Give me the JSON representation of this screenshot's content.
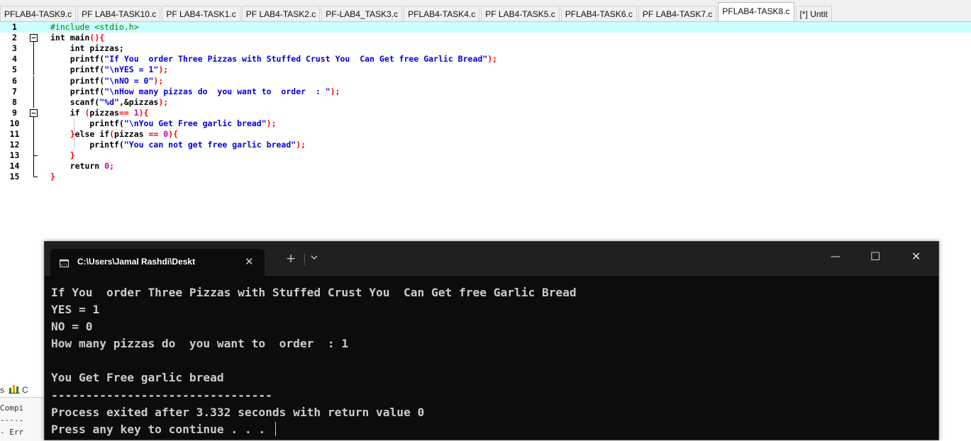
{
  "tabs": [
    {
      "label": "PFLAB4-TASK9.c",
      "active": false
    },
    {
      "label": "PF LAB4-TASK10.c",
      "active": false
    },
    {
      "label": "PF LAB4-TASK1.c",
      "active": false
    },
    {
      "label": "PF LAB4-TASK2.c",
      "active": false
    },
    {
      "label": "PF-LAB4_TASK3.c",
      "active": false
    },
    {
      "label": "PFLAB4-TASK4.c",
      "active": false
    },
    {
      "label": "PF LAB4-TASK5.c",
      "active": false
    },
    {
      "label": "PFLAB4-TASK6.c",
      "active": false
    },
    {
      "label": "PF LAB4-TASK7.c",
      "active": false
    },
    {
      "label": "PFLAB4-TASK8.c",
      "active": true
    },
    {
      "label": "[*] Untit",
      "active": false
    }
  ],
  "editor": {
    "lines": [
      {
        "n": "1",
        "fold": "",
        "parts": [
          [
            "pp",
            "#include <stdio.h>"
          ]
        ],
        "current": true
      },
      {
        "n": "2",
        "fold": "box",
        "parts": [
          [
            "kw",
            "int "
          ],
          [
            "tx",
            "main"
          ],
          [
            "br",
            "(){"
          ]
        ]
      },
      {
        "n": "3",
        "fold": "line",
        "parts": [
          [
            "tx",
            "    int pizzas;"
          ]
        ]
      },
      {
        "n": "4",
        "fold": "line",
        "parts": [
          [
            "tx",
            "    printf("
          ],
          [
            "str",
            "\"If You  order Three Pizzas with Stuffed Crust You  Can Get free Garlic Bread\""
          ],
          [
            "br",
            ");"
          ]
        ]
      },
      {
        "n": "5",
        "fold": "line",
        "parts": [
          [
            "tx",
            "    printf("
          ],
          [
            "str",
            "\"\\nYES = 1\""
          ],
          [
            "br",
            ");"
          ]
        ]
      },
      {
        "n": "6",
        "fold": "line",
        "parts": [
          [
            "tx",
            "    printf("
          ],
          [
            "str",
            "\"\\nNO = 0\""
          ],
          [
            "br",
            ");"
          ]
        ]
      },
      {
        "n": "7",
        "fold": "line",
        "parts": [
          [
            "tx",
            "    printf("
          ],
          [
            "str",
            "\"\\nHow many pizzas do  you want to  order  : \""
          ],
          [
            "br",
            ");"
          ]
        ]
      },
      {
        "n": "8",
        "fold": "line",
        "parts": [
          [
            "tx",
            "    scanf("
          ],
          [
            "str",
            "\"%d\""
          ],
          [
            "tx",
            ",&pizzas"
          ],
          [
            "br",
            ");"
          ]
        ]
      },
      {
        "n": "9",
        "fold": "box",
        "parts": [
          [
            "tx",
            "    if "
          ],
          [
            "br",
            "("
          ],
          [
            "tx",
            "pizzas"
          ],
          [
            "br",
            "== "
          ],
          [
            "num",
            "1"
          ],
          [
            "br",
            "){"
          ]
        ]
      },
      {
        "n": "10",
        "fold": "line",
        "parts": [
          [
            "tx",
            "        printf("
          ],
          [
            "str",
            "\"\\nYou Get Free garlic bread\""
          ],
          [
            "br",
            ");"
          ]
        ]
      },
      {
        "n": "11",
        "fold": "line",
        "parts": [
          [
            "br",
            "    }"
          ],
          [
            "tx",
            "else if"
          ],
          [
            "br",
            "("
          ],
          [
            "tx",
            "pizzas "
          ],
          [
            "br",
            "== "
          ],
          [
            "num",
            "0"
          ],
          [
            "br",
            "){"
          ]
        ]
      },
      {
        "n": "12",
        "fold": "line",
        "parts": [
          [
            "tx",
            "        printf("
          ],
          [
            "str",
            "\"You can not get free garlic bread\""
          ],
          [
            "br",
            ");"
          ]
        ]
      },
      {
        "n": "13",
        "fold": "end",
        "parts": [
          [
            "br",
            "    }"
          ]
        ]
      },
      {
        "n": "14",
        "fold": "line",
        "parts": [
          [
            "tx",
            "    return "
          ],
          [
            "num",
            "0"
          ],
          [
            "br",
            ";"
          ]
        ]
      },
      {
        "n": "15",
        "fold": "last",
        "parts": [
          [
            "br",
            "}"
          ]
        ]
      }
    ]
  },
  "bottom_panel": {
    "tab_fragment": "s",
    "tab_icon": "bar-chart-icon",
    "tab_letter": "C",
    "log_line1": "Compi",
    "log_line2": "-----",
    "log_line3": "- Err"
  },
  "terminal": {
    "tab_title": "C:\\Users\\Jamal Rashdi\\Deskt",
    "tab_icon": "console-icon",
    "close_glyph": "✕",
    "new_tab_glyph": "+",
    "dropdown_icon": "chevron-down-icon",
    "minimize_glyph": "—",
    "maximize_glyph": "☐",
    "window_close_glyph": "✕",
    "output_lines": [
      "If You  order Three Pizzas with Stuffed Crust You  Can Get free Garlic Bread",
      "YES = 1",
      "NO = 0",
      "How many pizzas do  you want to  order  : 1",
      "",
      "You Get Free garlic bread",
      "--------------------------------",
      "Process exited after 3.332 seconds with return value 0",
      "Press any key to continue . . . "
    ]
  },
  "colors": {
    "current_line": "#ccffff",
    "string": "#0000e0",
    "preprocessor": "#008000",
    "number": "#c000c0",
    "brace": "#ff0000",
    "terminal_bg": "#0c0c0c",
    "terminal_text": "#cccccc"
  }
}
